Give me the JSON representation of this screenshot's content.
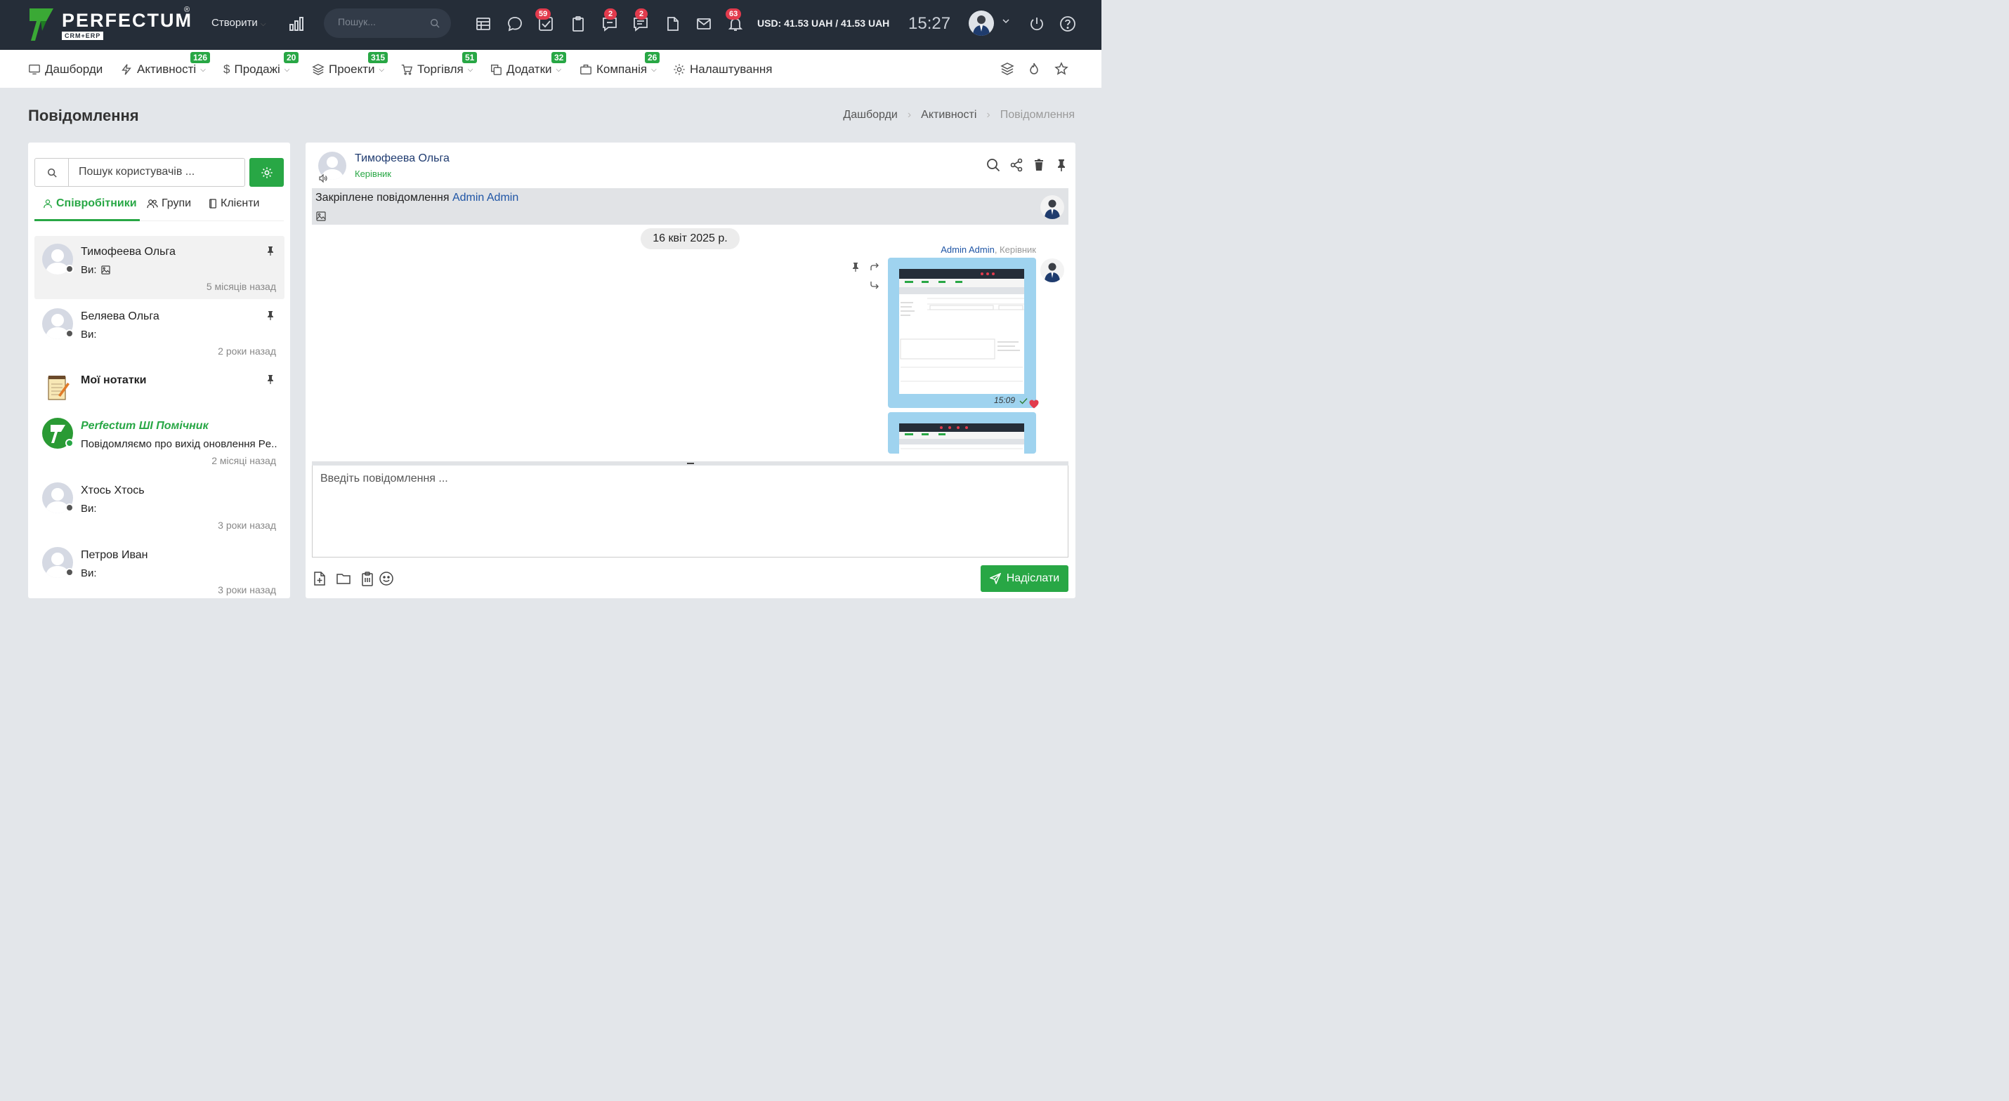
{
  "topbar": {
    "logo_text": "PERFECTUM",
    "logo_sub": "CRM+ERP",
    "create_label": "Створити",
    "search_placeholder": "Пошук...",
    "badges": {
      "tasks": "59",
      "chat": "2",
      "messages": "2",
      "notifications": "63"
    },
    "currency": "USD: 41.53 UAH / 41.53 UAH",
    "time": "15:27"
  },
  "nav": {
    "items": [
      {
        "label": "Дашборди",
        "badge": ""
      },
      {
        "label": "Активності",
        "badge": "126"
      },
      {
        "label": "Продажі",
        "badge": "20"
      },
      {
        "label": "Проекти",
        "badge": "315"
      },
      {
        "label": "Торгівля",
        "badge": "51"
      },
      {
        "label": "Додатки",
        "badge": "32"
      },
      {
        "label": "Компанія",
        "badge": "26"
      },
      {
        "label": "Налаштування",
        "badge": ""
      }
    ]
  },
  "page": {
    "title": "Повідомлення",
    "breadcrumb": [
      "Дашборди",
      "Активності",
      "Повідомлення"
    ]
  },
  "sidebar": {
    "search_placeholder": "Пошук користувачів ...",
    "tabs": [
      "Співробітники",
      "Групи",
      "Клієнти"
    ],
    "contacts": [
      {
        "name": "Тимофеева Ольга",
        "preview": "Ви:",
        "time": "5 місяців назад"
      },
      {
        "name": "Беляева Ольга",
        "preview": "Ви:",
        "time": "2 роки назад"
      },
      {
        "name": "Мої нотатки",
        "preview": "",
        "time": ""
      },
      {
        "name": "Perfectum ШІ Помічник",
        "preview": "Повідомляємо про вихід оновлення Pe...",
        "time": "2 місяці назад"
      },
      {
        "name": "Хтось Хтось",
        "preview": "Ви:",
        "time": "3 роки назад"
      },
      {
        "name": "Петров Иван",
        "preview": "Ви:",
        "time": "3 роки назад"
      }
    ]
  },
  "chat": {
    "name": "Тимофеева Ольга",
    "role": "Керівник",
    "pinned_label": "Закріплене повідомлення",
    "pinned_author": "Admin Admin",
    "date": "16 квіт 2025 р.",
    "msg_author": "Admin Admin",
    "msg_role": ", Керівник",
    "msg_time": "15:09",
    "compose_placeholder": "Введіть повідомлення ...",
    "send_label": "Надіслати"
  },
  "colors": {
    "accent": "#28a745",
    "topbar": "#252d38",
    "badge": "#e23b4d",
    "bubble": "#9fd3ef"
  }
}
